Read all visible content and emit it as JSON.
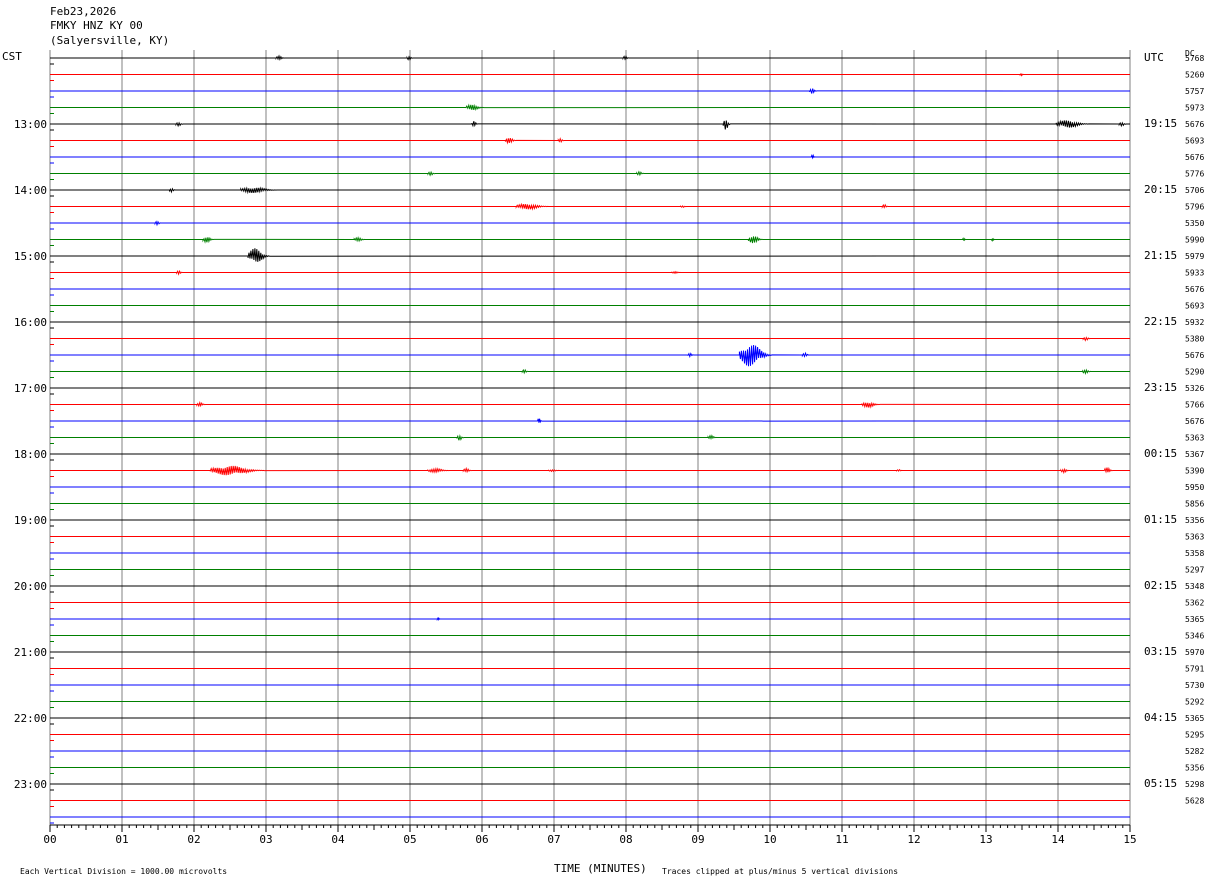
{
  "header": {
    "date": "Feb23,2026",
    "station": "FMKY HNZ KY 00",
    "location": "(Salyersville, KY)"
  },
  "left_label": "CST",
  "right_label": "UTC",
  "dc_label": "DC",
  "footer": {
    "left": "Each Vertical Division = 1000.00 microvolts",
    "right": "Traces clipped at plus/minus 5 vertical divisions"
  },
  "colors": {
    "trace_cycle": [
      "#000000",
      "#ff0000",
      "#0000ff",
      "#008000"
    ],
    "grid": "#808080"
  },
  "chart_data": {
    "type": "line",
    "title": "FMKY HNZ KY 00",
    "xlabel": "TIME (MINUTES)",
    "ylabel": "",
    "xlim": [
      0,
      15
    ],
    "x_ticks": [
      "00",
      "01",
      "02",
      "03",
      "04",
      "05",
      "06",
      "07",
      "08",
      "09",
      "10",
      "11",
      "12",
      "13",
      "14",
      "15"
    ],
    "left_time_labels": [
      {
        "row": 4,
        "label": "13:00"
      },
      {
        "row": 8,
        "label": "14:00"
      },
      {
        "row": 12,
        "label": "15:00"
      },
      {
        "row": 16,
        "label": "16:00"
      },
      {
        "row": 20,
        "label": "17:00"
      },
      {
        "row": 24,
        "label": "18:00"
      },
      {
        "row": 28,
        "label": "19:00"
      },
      {
        "row": 32,
        "label": "20:00"
      },
      {
        "row": 36,
        "label": "21:00"
      },
      {
        "row": 40,
        "label": "22:00"
      },
      {
        "row": 44,
        "label": "23:00"
      }
    ],
    "right_time_labels": [
      {
        "row": 0,
        "label": "UTC"
      },
      {
        "row": 4,
        "label": "19:15"
      },
      {
        "row": 8,
        "label": "20:15"
      },
      {
        "row": 12,
        "label": "21:15"
      },
      {
        "row": 16,
        "label": "22:15"
      },
      {
        "row": 20,
        "label": "23:15"
      },
      {
        "row": 24,
        "label": "00:15"
      },
      {
        "row": 28,
        "label": "01:15"
      },
      {
        "row": 32,
        "label": "02:15"
      },
      {
        "row": 36,
        "label": "03:15"
      },
      {
        "row": 40,
        "label": "04:15"
      },
      {
        "row": 44,
        "label": "05:15"
      }
    ],
    "dc_values": [
      "5768",
      "5260",
      "5757",
      "5973",
      "5676",
      "5693",
      "5676",
      "5776",
      "5706",
      "5796",
      "5350",
      "5990",
      "5979",
      "5933",
      "5676",
      "5693",
      "5932",
      "5380",
      "5676",
      "5290",
      "5326",
      "5766",
      "5676",
      "5363",
      "5367",
      "5390",
      "5950",
      "5856",
      "5356",
      "5363",
      "5358",
      "5297",
      "5348",
      "5362",
      "5365",
      "5346",
      "5970",
      "5791",
      "5730",
      "5292",
      "5365",
      "5295",
      "5282",
      "5356",
      "5298",
      "5628"
    ],
    "events": [
      {
        "row": 0,
        "minute": 3.2,
        "amp": 2,
        "width": 0.12
      },
      {
        "row": 0,
        "minute": 5.0,
        "amp": 2,
        "width": 0.08
      },
      {
        "row": 0,
        "minute": 8.0,
        "amp": 2,
        "width": 0.08
      },
      {
        "row": 1,
        "minute": 13.5,
        "amp": 1,
        "width": 0.05
      },
      {
        "row": 2,
        "minute": 10.6,
        "amp": 3,
        "width": 0.1
      },
      {
        "row": 3,
        "minute": 5.9,
        "amp": 3,
        "width": 0.25
      },
      {
        "row": 4,
        "minute": 1.8,
        "amp": 2,
        "width": 0.1
      },
      {
        "row": 4,
        "minute": 5.9,
        "amp": 3,
        "width": 0.08
      },
      {
        "row": 4,
        "minute": 9.4,
        "amp": 6,
        "width": 0.1
      },
      {
        "row": 4,
        "minute": 14.2,
        "amp": 4,
        "width": 0.45
      },
      {
        "row": 4,
        "minute": 14.9,
        "amp": 2,
        "width": 0.1
      },
      {
        "row": 5,
        "minute": 6.4,
        "amp": 3,
        "width": 0.15
      },
      {
        "row": 5,
        "minute": 7.1,
        "amp": 2,
        "width": 0.08
      },
      {
        "row": 6,
        "minute": 10.6,
        "amp": 2,
        "width": 0.06
      },
      {
        "row": 7,
        "minute": 5.3,
        "amp": 2,
        "width": 0.1
      },
      {
        "row": 7,
        "minute": 8.2,
        "amp": 2,
        "width": 0.1
      },
      {
        "row": 8,
        "minute": 1.7,
        "amp": 2,
        "width": 0.08
      },
      {
        "row": 8,
        "minute": 2.9,
        "amp": 3,
        "width": 0.5
      },
      {
        "row": 9,
        "minute": 6.7,
        "amp": 3,
        "width": 0.45
      },
      {
        "row": 9,
        "minute": 8.8,
        "amp": 1,
        "width": 0.08
      },
      {
        "row": 9,
        "minute": 11.6,
        "amp": 2,
        "width": 0.08
      },
      {
        "row": 10,
        "minute": 1.5,
        "amp": 2,
        "width": 0.08
      },
      {
        "row": 11,
        "minute": 2.2,
        "amp": 3,
        "width": 0.15
      },
      {
        "row": 11,
        "minute": 4.3,
        "amp": 2,
        "width": 0.15
      },
      {
        "row": 11,
        "minute": 9.8,
        "amp": 4,
        "width": 0.2
      },
      {
        "row": 11,
        "minute": 12.7,
        "amp": 1,
        "width": 0.04
      },
      {
        "row": 11,
        "minute": 13.1,
        "amp": 1,
        "width": 0.04
      },
      {
        "row": 12,
        "minute": 2.9,
        "amp": 8,
        "width": 0.3
      },
      {
        "row": 13,
        "minute": 1.8,
        "amp": 2,
        "width": 0.08
      },
      {
        "row": 13,
        "minute": 8.7,
        "amp": 1,
        "width": 0.12
      },
      {
        "row": 17,
        "minute": 14.4,
        "amp": 2,
        "width": 0.1
      },
      {
        "row": 18,
        "minute": 8.9,
        "amp": 2,
        "width": 0.08
      },
      {
        "row": 18,
        "minute": 9.8,
        "amp": 12,
        "width": 0.45
      },
      {
        "row": 18,
        "minute": 10.5,
        "amp": 2,
        "width": 0.1
      },
      {
        "row": 19,
        "minute": 6.6,
        "amp": 2,
        "width": 0.08
      },
      {
        "row": 19,
        "minute": 14.4,
        "amp": 2,
        "width": 0.12
      },
      {
        "row": 21,
        "minute": 2.1,
        "amp": 2,
        "width": 0.12
      },
      {
        "row": 21,
        "minute": 11.4,
        "amp": 3,
        "width": 0.25
      },
      {
        "row": 22,
        "minute": 6.8,
        "amp": 3,
        "width": 0.06
      },
      {
        "row": 23,
        "minute": 5.7,
        "amp": 3,
        "width": 0.1
      },
      {
        "row": 23,
        "minute": 9.2,
        "amp": 2,
        "width": 0.12
      },
      {
        "row": 25,
        "minute": 2.6,
        "amp": 5,
        "width": 0.75
      },
      {
        "row": 25,
        "minute": 5.4,
        "amp": 2,
        "width": 0.3
      },
      {
        "row": 25,
        "minute": 5.8,
        "amp": 2,
        "width": 0.12
      },
      {
        "row": 25,
        "minute": 7.0,
        "amp": 1,
        "width": 0.15
      },
      {
        "row": 25,
        "minute": 11.8,
        "amp": 1,
        "width": 0.08
      },
      {
        "row": 25,
        "minute": 14.1,
        "amp": 2,
        "width": 0.12
      },
      {
        "row": 25,
        "minute": 14.7,
        "amp": 3,
        "width": 0.12
      },
      {
        "row": 34,
        "minute": 5.4,
        "amp": 1,
        "width": 0.03
      }
    ],
    "grid": true,
    "rows": 47
  }
}
